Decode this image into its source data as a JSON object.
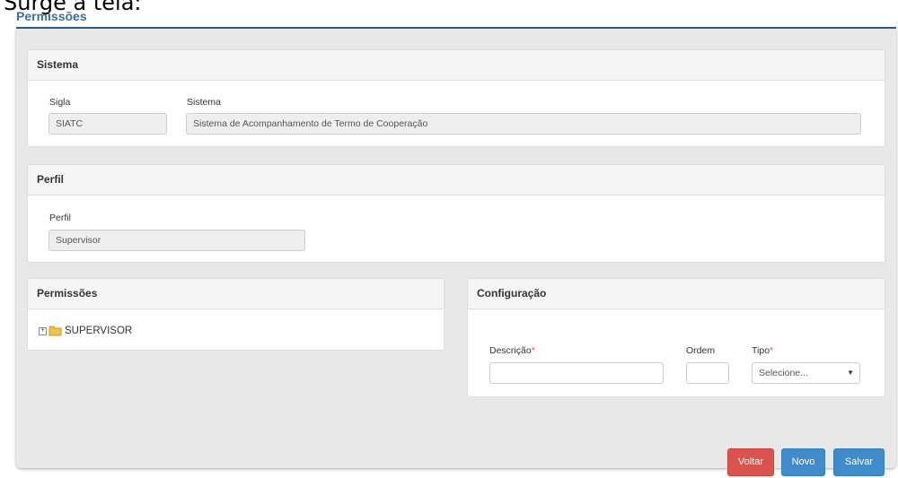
{
  "caption": "Surge a tela:",
  "page_title": "Permissões",
  "sistema": {
    "heading": "Sistema",
    "sigla_label": "Sigla",
    "sigla_value": "SIATC",
    "sistema_label": "Sistema",
    "sistema_value": "Sistema de Acompanhamento de Termo de Cooperação"
  },
  "perfil": {
    "heading": "Perfil",
    "perfil_label": "Perfil",
    "perfil_value": "Supervisor"
  },
  "permissoes": {
    "heading": "Permissões",
    "tree_root": "SUPERVISOR",
    "expand_glyph": "+"
  },
  "configuracao": {
    "heading": "Configuração",
    "descricao_label": "Descrição",
    "descricao_value": "",
    "ordem_label": "Ordem",
    "ordem_value": "",
    "tipo_label": "Tipo",
    "tipo_value": "Selecione...",
    "required_mark": "*"
  },
  "buttons": {
    "voltar": "Voltar",
    "novo": "Novo",
    "salvar": "Salvar"
  },
  "colors": {
    "title": "#3f6da0",
    "danger": "#d9534f",
    "primary": "#428bca"
  },
  "icons": {
    "folder": "folder-icon",
    "expand": "expand-plus-icon",
    "dropdown": "caret-down-icon"
  }
}
